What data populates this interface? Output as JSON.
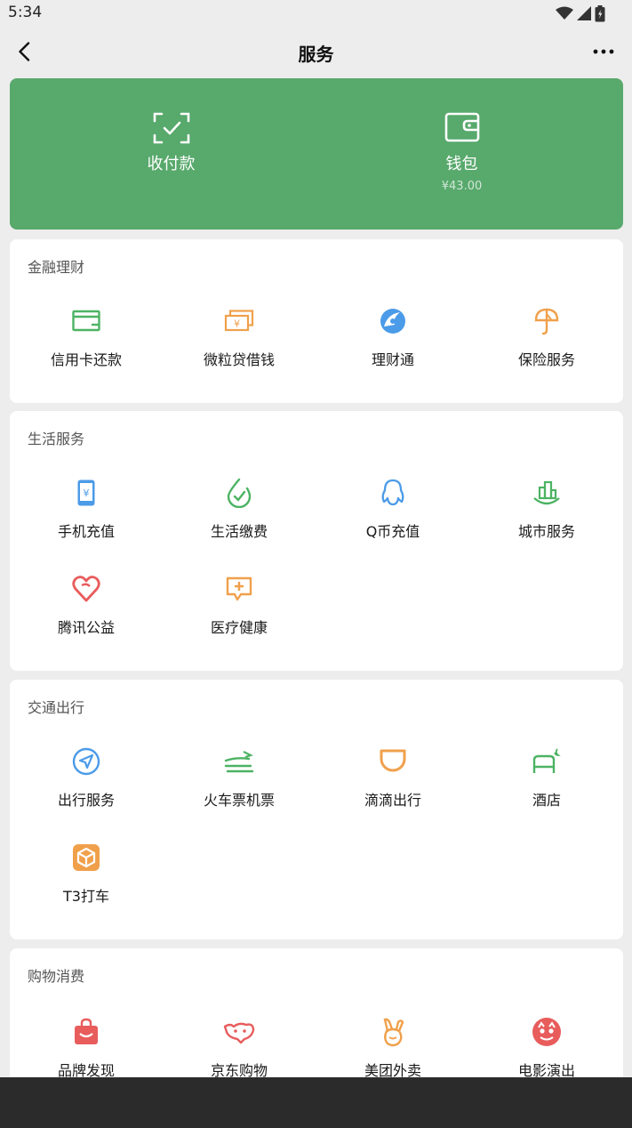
{
  "status": {
    "time": "5:34"
  },
  "header": {
    "title": "服务"
  },
  "wallet": {
    "pay": {
      "label": "收付款"
    },
    "purse": {
      "label": "钱包",
      "balance": "¥43.00"
    }
  },
  "sections": {
    "finance": {
      "title": "金融理财",
      "items": [
        "信用卡还款",
        "微粒贷借钱",
        "理财通",
        "保险服务"
      ]
    },
    "life": {
      "title": "生活服务",
      "items": [
        "手机充值",
        "生活缴费",
        "Q币充值",
        "城市服务",
        "腾讯公益",
        "医疗健康"
      ]
    },
    "transport": {
      "title": "交通出行",
      "items": [
        "出行服务",
        "火车票机票",
        "滴滴出行",
        "酒店",
        "T3打车"
      ]
    },
    "shopping": {
      "title": "购物消费",
      "items": [
        "品牌发现",
        "京东购物",
        "美团外卖",
        "电影演出"
      ]
    }
  },
  "colors": {
    "wallet_bg": "#58a96c",
    "green": "#4cb363",
    "orange": "#f0a04b",
    "blue": "#4b9be8",
    "red": "#e85c5c"
  }
}
